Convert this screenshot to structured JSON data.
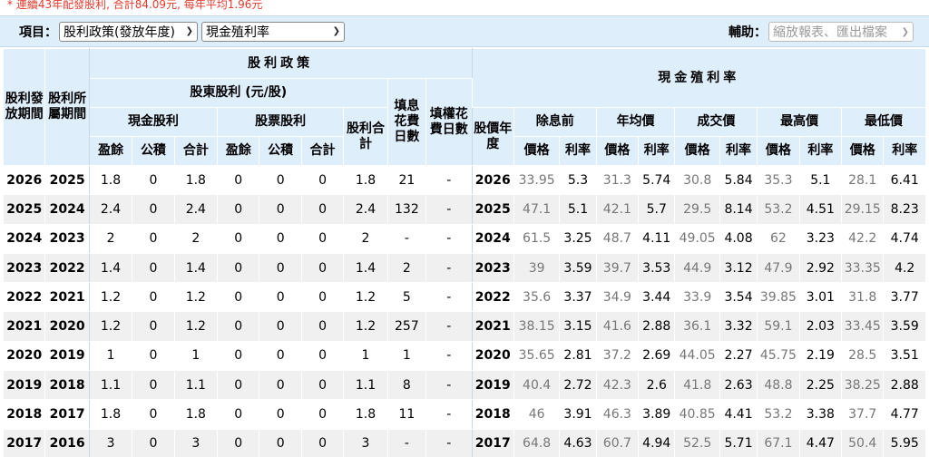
{
  "notice": "* 連續43年配發股利, 合計84.09元, 每年平均1.96元",
  "toolbar": {
    "item_label": "項目：",
    "select_policy": "股利政策(發放年度)",
    "select_yield": "現金殖利率",
    "aux_label": "輔助：",
    "aux_select": "縮放報表、匯出檔案"
  },
  "headers": {
    "dist_period": "股利發放期間",
    "belong_period": "股利所屬期間",
    "policy": "股利政策",
    "shareholder_div": "股東股利 (元/股)",
    "cash_div": "現金股利",
    "stock_div": "股票股利",
    "div_total": "股利合計",
    "fill_div_days": "填息花費日數",
    "fill_right_days": "填權花費日數",
    "cash_yield": "現金殖利率",
    "price_year": "股價年度",
    "before_ex": "除息前",
    "annual_avg": "年均價",
    "trade_price": "成交價",
    "high_price": "最高價",
    "low_price": "最低價",
    "earnings": "盈餘",
    "reserve": "公積",
    "total": "合計",
    "price": "價格",
    "rate": "利率"
  },
  "rows": [
    [
      "2026",
      "2025",
      "1.8",
      "0",
      "1.8",
      "0",
      "0",
      "0",
      "1.8",
      "21",
      "-",
      "2026",
      "33.95",
      "5.3",
      "31.3",
      "5.74",
      "30.8",
      "5.84",
      "35.3",
      "5.1",
      "28.1",
      "6.41"
    ],
    [
      "2025",
      "2024",
      "2.4",
      "0",
      "2.4",
      "0",
      "0",
      "0",
      "2.4",
      "132",
      "-",
      "2025",
      "47.1",
      "5.1",
      "42.1",
      "5.7",
      "29.5",
      "8.14",
      "53.2",
      "4.51",
      "29.15",
      "8.23"
    ],
    [
      "2024",
      "2023",
      "2",
      "0",
      "2",
      "0",
      "0",
      "0",
      "2",
      "-",
      "-",
      "2024",
      "61.5",
      "3.25",
      "48.7",
      "4.11",
      "49.05",
      "4.08",
      "62",
      "3.23",
      "42.2",
      "4.74"
    ],
    [
      "2023",
      "2022",
      "1.4",
      "0",
      "1.4",
      "0",
      "0",
      "0",
      "1.4",
      "2",
      "-",
      "2023",
      "39",
      "3.59",
      "39.7",
      "3.53",
      "44.9",
      "3.12",
      "47.9",
      "2.92",
      "33.35",
      "4.2"
    ],
    [
      "2022",
      "2021",
      "1.2",
      "0",
      "1.2",
      "0",
      "0",
      "0",
      "1.2",
      "5",
      "-",
      "2022",
      "35.6",
      "3.37",
      "34.9",
      "3.44",
      "33.9",
      "3.54",
      "39.85",
      "3.01",
      "31.8",
      "3.77"
    ],
    [
      "2021",
      "2020",
      "1.2",
      "0",
      "1.2",
      "0",
      "0",
      "0",
      "1.2",
      "257",
      "-",
      "2021",
      "38.15",
      "3.15",
      "41.6",
      "2.88",
      "36.1",
      "3.32",
      "59.1",
      "2.03",
      "33.45",
      "3.59"
    ],
    [
      "2020",
      "2019",
      "1",
      "0",
      "1",
      "0",
      "0",
      "0",
      "1",
      "1",
      "-",
      "2020",
      "35.65",
      "2.81",
      "37.2",
      "2.69",
      "44.05",
      "2.27",
      "45.75",
      "2.19",
      "28.5",
      "3.51"
    ],
    [
      "2019",
      "2018",
      "1.1",
      "0",
      "1.1",
      "0",
      "0",
      "0",
      "1.1",
      "8",
      "-",
      "2019",
      "40.4",
      "2.72",
      "42.3",
      "2.6",
      "41.8",
      "2.63",
      "48.8",
      "2.25",
      "38.25",
      "2.88"
    ],
    [
      "2018",
      "2017",
      "1.8",
      "0",
      "1.8",
      "0",
      "0",
      "0",
      "1.8",
      "11",
      "-",
      "2018",
      "46",
      "3.91",
      "46.3",
      "3.89",
      "40.85",
      "4.41",
      "53.2",
      "3.38",
      "37.7",
      "4.77"
    ],
    [
      "2017",
      "2016",
      "3",
      "0",
      "3",
      "0",
      "0",
      "0",
      "3",
      "-",
      "-",
      "2017",
      "64.8",
      "4.63",
      "60.7",
      "4.94",
      "52.5",
      "5.71",
      "67.1",
      "4.47",
      "50.4",
      "5.95"
    ]
  ]
}
